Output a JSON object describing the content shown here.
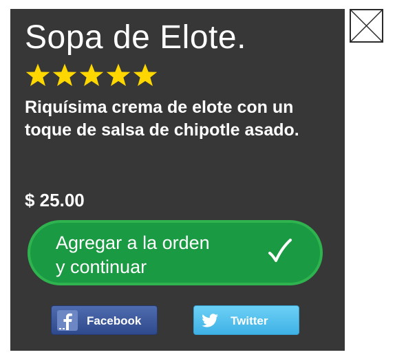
{
  "dish": {
    "title": "Sopa de Elote.",
    "rating": 5,
    "rating_max": 5,
    "description": "Riquísima crema de elote con un toque de salsa de chipotle asado.",
    "price": "$ 25.00"
  },
  "actions": {
    "add_line1": "Agregar a la orden",
    "add_line2": "y continuar"
  },
  "share": {
    "facebook_label": "Facebook",
    "twitter_label": "Twitter"
  },
  "icons": {
    "close": "close-icon",
    "star": "star-icon",
    "check": "check-icon",
    "facebook": "facebook-icon",
    "twitter": "twitter-icon"
  },
  "colors": {
    "card_background": "#373737",
    "star": "#ffd700",
    "button_green": "#1a9a42",
    "button_border": "#2fb34f",
    "facebook": "#3b5998",
    "twitter": "#55c2ee"
  }
}
